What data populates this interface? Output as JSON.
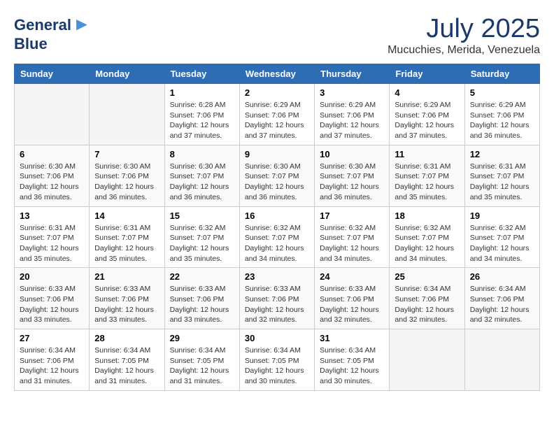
{
  "header": {
    "logo_line1": "General",
    "logo_line2": "Blue",
    "month_year": "July 2025",
    "location": "Mucuchies, Merida, Venezuela"
  },
  "days_of_week": [
    "Sunday",
    "Monday",
    "Tuesday",
    "Wednesday",
    "Thursday",
    "Friday",
    "Saturday"
  ],
  "weeks": [
    [
      {
        "day": "",
        "info": ""
      },
      {
        "day": "",
        "info": ""
      },
      {
        "day": "1",
        "info": "Sunrise: 6:28 AM\nSunset: 7:06 PM\nDaylight: 12 hours and 37 minutes."
      },
      {
        "day": "2",
        "info": "Sunrise: 6:29 AM\nSunset: 7:06 PM\nDaylight: 12 hours and 37 minutes."
      },
      {
        "day": "3",
        "info": "Sunrise: 6:29 AM\nSunset: 7:06 PM\nDaylight: 12 hours and 37 minutes."
      },
      {
        "day": "4",
        "info": "Sunrise: 6:29 AM\nSunset: 7:06 PM\nDaylight: 12 hours and 37 minutes."
      },
      {
        "day": "5",
        "info": "Sunrise: 6:29 AM\nSunset: 7:06 PM\nDaylight: 12 hours and 36 minutes."
      }
    ],
    [
      {
        "day": "6",
        "info": "Sunrise: 6:30 AM\nSunset: 7:06 PM\nDaylight: 12 hours and 36 minutes."
      },
      {
        "day": "7",
        "info": "Sunrise: 6:30 AM\nSunset: 7:06 PM\nDaylight: 12 hours and 36 minutes."
      },
      {
        "day": "8",
        "info": "Sunrise: 6:30 AM\nSunset: 7:07 PM\nDaylight: 12 hours and 36 minutes."
      },
      {
        "day": "9",
        "info": "Sunrise: 6:30 AM\nSunset: 7:07 PM\nDaylight: 12 hours and 36 minutes."
      },
      {
        "day": "10",
        "info": "Sunrise: 6:30 AM\nSunset: 7:07 PM\nDaylight: 12 hours and 36 minutes."
      },
      {
        "day": "11",
        "info": "Sunrise: 6:31 AM\nSunset: 7:07 PM\nDaylight: 12 hours and 35 minutes."
      },
      {
        "day": "12",
        "info": "Sunrise: 6:31 AM\nSunset: 7:07 PM\nDaylight: 12 hours and 35 minutes."
      }
    ],
    [
      {
        "day": "13",
        "info": "Sunrise: 6:31 AM\nSunset: 7:07 PM\nDaylight: 12 hours and 35 minutes."
      },
      {
        "day": "14",
        "info": "Sunrise: 6:31 AM\nSunset: 7:07 PM\nDaylight: 12 hours and 35 minutes."
      },
      {
        "day": "15",
        "info": "Sunrise: 6:32 AM\nSunset: 7:07 PM\nDaylight: 12 hours and 35 minutes."
      },
      {
        "day": "16",
        "info": "Sunrise: 6:32 AM\nSunset: 7:07 PM\nDaylight: 12 hours and 34 minutes."
      },
      {
        "day": "17",
        "info": "Sunrise: 6:32 AM\nSunset: 7:07 PM\nDaylight: 12 hours and 34 minutes."
      },
      {
        "day": "18",
        "info": "Sunrise: 6:32 AM\nSunset: 7:07 PM\nDaylight: 12 hours and 34 minutes."
      },
      {
        "day": "19",
        "info": "Sunrise: 6:32 AM\nSunset: 7:07 PM\nDaylight: 12 hours and 34 minutes."
      }
    ],
    [
      {
        "day": "20",
        "info": "Sunrise: 6:33 AM\nSunset: 7:06 PM\nDaylight: 12 hours and 33 minutes."
      },
      {
        "day": "21",
        "info": "Sunrise: 6:33 AM\nSunset: 7:06 PM\nDaylight: 12 hours and 33 minutes."
      },
      {
        "day": "22",
        "info": "Sunrise: 6:33 AM\nSunset: 7:06 PM\nDaylight: 12 hours and 33 minutes."
      },
      {
        "day": "23",
        "info": "Sunrise: 6:33 AM\nSunset: 7:06 PM\nDaylight: 12 hours and 32 minutes."
      },
      {
        "day": "24",
        "info": "Sunrise: 6:33 AM\nSunset: 7:06 PM\nDaylight: 12 hours and 32 minutes."
      },
      {
        "day": "25",
        "info": "Sunrise: 6:34 AM\nSunset: 7:06 PM\nDaylight: 12 hours and 32 minutes."
      },
      {
        "day": "26",
        "info": "Sunrise: 6:34 AM\nSunset: 7:06 PM\nDaylight: 12 hours and 32 minutes."
      }
    ],
    [
      {
        "day": "27",
        "info": "Sunrise: 6:34 AM\nSunset: 7:06 PM\nDaylight: 12 hours and 31 minutes."
      },
      {
        "day": "28",
        "info": "Sunrise: 6:34 AM\nSunset: 7:05 PM\nDaylight: 12 hours and 31 minutes."
      },
      {
        "day": "29",
        "info": "Sunrise: 6:34 AM\nSunset: 7:05 PM\nDaylight: 12 hours and 31 minutes."
      },
      {
        "day": "30",
        "info": "Sunrise: 6:34 AM\nSunset: 7:05 PM\nDaylight: 12 hours and 30 minutes."
      },
      {
        "day": "31",
        "info": "Sunrise: 6:34 AM\nSunset: 7:05 PM\nDaylight: 12 hours and 30 minutes."
      },
      {
        "day": "",
        "info": ""
      },
      {
        "day": "",
        "info": ""
      }
    ]
  ]
}
